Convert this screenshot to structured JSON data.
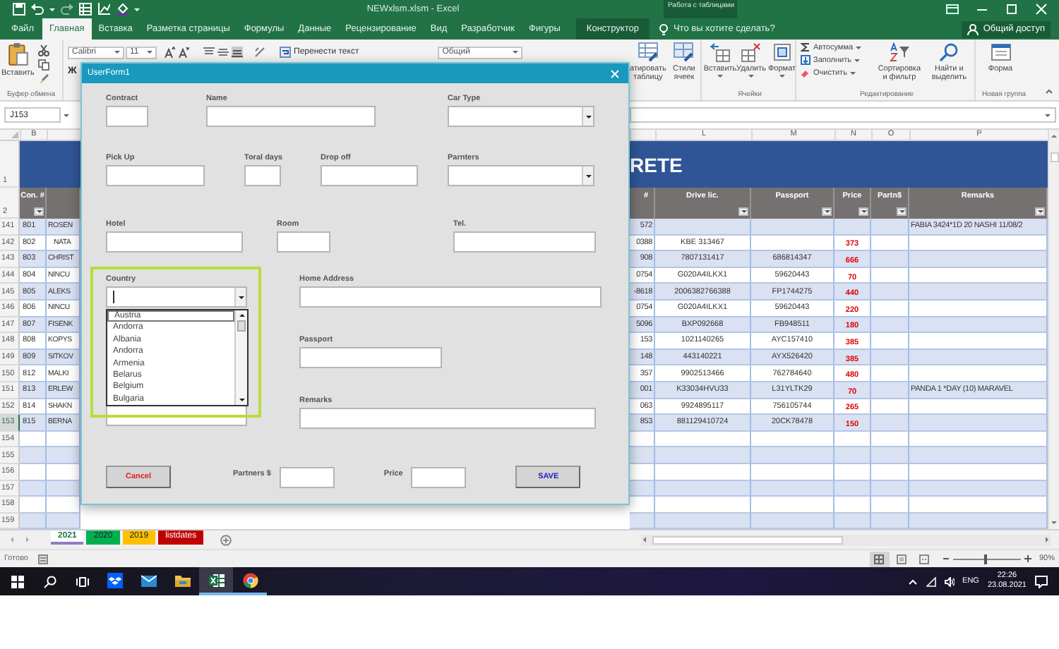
{
  "title_bar": {
    "title": "NEWxlsm.xlsm - Excel",
    "context_label": "Работа с таблицами"
  },
  "ribbon_tabs": [
    {
      "label": "Файл",
      "kind": "file",
      "selected": false
    },
    {
      "label": "Главная",
      "kind": "standard",
      "selected": true
    },
    {
      "label": "Вставка",
      "kind": "standard",
      "selected": false
    },
    {
      "label": "Разметка страницы",
      "kind": "standard",
      "selected": false
    },
    {
      "label": "Формулы",
      "kind": "standard",
      "selected": false
    },
    {
      "label": "Данные",
      "kind": "standard",
      "selected": false
    },
    {
      "label": "Рецензирование",
      "kind": "standard",
      "selected": false
    },
    {
      "label": "Вид",
      "kind": "standard",
      "selected": false
    },
    {
      "label": "Разработчик",
      "kind": "standard",
      "selected": false
    },
    {
      "label": "Фигуры",
      "kind": "standard",
      "selected": false
    },
    {
      "label": "Конструктор",
      "kind": "context",
      "selected": false
    }
  ],
  "tell_me": "Что вы хотите сделать?",
  "share": "Общий доступ",
  "ribbon": {
    "paste": "Вставить",
    "clipboard_group": "Буфер обмена",
    "bold": "Ж",
    "font": "Calibri",
    "font_size": "11",
    "wrap_text": "Перенести текст",
    "number_format": "Общий",
    "format_as_table": "атировать таблицу",
    "cell_styles": "Стили ячеек",
    "cell_buttons": [
      "Вставить",
      "Удалить",
      "Формат"
    ],
    "cells_group": "Ячейки",
    "editing_items": [
      "Автосумма",
      "Заполнить",
      "Очистить"
    ],
    "sort": "Сортировка и фильтр",
    "find": "Найти и выделить",
    "editing_group": "Редактирование",
    "form": "Форма",
    "new_group": "Новая группа"
  },
  "name_box": "J153",
  "sheet": {
    "header_rows": [
      "1",
      "2"
    ],
    "columns_left": [
      "B"
    ],
    "columns_right": [
      "L",
      "M",
      "N",
      "O",
      "P"
    ],
    "banner": "RETE",
    "header_left": "Con. #",
    "header_k": "#",
    "headers_right": [
      "Drive lic.",
      "Passport",
      "Price",
      "Partn$",
      "Remarks"
    ],
    "rows": [
      {
        "num": "141",
        "con": "801",
        "name": "ROSEN",
        "k": "572",
        "remarks": "FABIA 3424*1D 20 NASHI 11/08/2",
        "selected": false
      },
      {
        "num": "142",
        "con": "802",
        "name": "NATA",
        "k": "0388",
        "drive": "KBE 313467",
        "price": "373",
        "selected": false
      },
      {
        "num": "143",
        "con": "803",
        "name": "CHRIST",
        "k": "908",
        "drive": "7807131417",
        "passport": "686814347",
        "price": "666",
        "selected": false
      },
      {
        "num": "144",
        "con": "804",
        "name": "NINCU",
        "k": "0754",
        "drive": "G020A4ILKX1",
        "passport": "59620443",
        "price": "70",
        "selected": false
      },
      {
        "num": "145",
        "con": "805",
        "name": "ALEKS",
        "k": "-8618",
        "drive": "2006382766388",
        "passport": "FP1744275",
        "price": "440",
        "selected": false
      },
      {
        "num": "146",
        "con": "806",
        "name": "NINCU",
        "k": "0754",
        "drive": "G020A4ILKX1",
        "passport": "59620443",
        "price": "220",
        "selected": false
      },
      {
        "num": "147",
        "con": "807",
        "name": "FISENK",
        "k": "5096",
        "drive": "BXP092668",
        "passport": "FB948511",
        "price": "180",
        "selected": false
      },
      {
        "num": "148",
        "con": "808",
        "name": "KOPYS",
        "k": "153",
        "drive": "1021140265",
        "passport": "AYC157410",
        "price": "385",
        "selected": false
      },
      {
        "num": "149",
        "con": "809",
        "name": "SITKOV",
        "k": "148",
        "drive": "443140221",
        "passport": "AYX526420",
        "price": "385",
        "selected": false
      },
      {
        "num": "150",
        "con": "812",
        "name": "MALKI",
        "k": "357",
        "drive": "9902513466",
        "passport": "762784640",
        "price": "480",
        "selected": false
      },
      {
        "num": "151",
        "con": "813",
        "name": "ERLEW",
        "k": "001",
        "drive": "K33034HVU33",
        "passport": "L31YLTK29",
        "price": "70",
        "remarks": "PANDA 1 *DAY (10) MARAVEL",
        "selected": false
      },
      {
        "num": "152",
        "con": "814",
        "name": "SHAKN",
        "k": "063",
        "drive": "9924895117",
        "passport": "756105744",
        "price": "265",
        "selected": false
      },
      {
        "num": "153",
        "con": "815",
        "name": "BERNA",
        "k": "853",
        "drive": "881129410724",
        "passport": "20CK78478",
        "price": "150",
        "selected": true
      },
      {
        "num": "154",
        "selected": false
      },
      {
        "num": "155",
        "selected": false
      },
      {
        "num": "156",
        "selected": false
      },
      {
        "num": "157",
        "selected": false
      },
      {
        "num": "158",
        "selected": false
      },
      {
        "num": "159",
        "selected": false
      }
    ]
  },
  "sheet_tabs": [
    {
      "label": "2021",
      "selected": true,
      "color": "#8e7cc3"
    },
    {
      "label": "2020",
      "selected": false,
      "color": "#00b050"
    },
    {
      "label": "2019",
      "selected": false,
      "color": "#ffc000"
    },
    {
      "label": "listdates",
      "selected": false,
      "color": "#c00000"
    }
  ],
  "status_bar": {
    "text": "Готово",
    "zoom": {
      "label": "90%",
      "level": 0.46
    }
  },
  "form": {
    "title": "UserForm1",
    "rows": [
      [
        {
          "label": "Contract",
          "kind": "text"
        },
        {
          "label": "Name",
          "kind": "text"
        },
        {
          "label": "Car Type",
          "kind": "combo"
        }
      ],
      [
        {
          "label": "Pick Up",
          "kind": "text"
        },
        {
          "label": "Toral days",
          "kind": "text"
        },
        {
          "label": "Drop off",
          "kind": "text"
        },
        {
          "label": "Parnters",
          "kind": "combo"
        }
      ],
      [
        {
          "label": "Hotel",
          "kind": "text"
        },
        {
          "label": "Room",
          "kind": "text"
        },
        {
          "label": "Tel.",
          "kind": "text"
        }
      ]
    ],
    "country": {
      "label": "Country",
      "options": [
        {
          "label": "Austria",
          "selected": true
        },
        {
          "label": "Andorra",
          "selected": false
        },
        {
          "label": "Albania",
          "selected": false
        },
        {
          "label": "Andorra",
          "selected": false
        },
        {
          "label": "Armenia",
          "selected": false
        },
        {
          "label": "Belarus",
          "selected": false
        },
        {
          "label": "Belgium",
          "selected": false
        },
        {
          "label": "Bulgaria",
          "selected": false
        }
      ]
    },
    "right_fields": [
      {
        "label": "Home Address"
      },
      {
        "label": "Passport"
      },
      {
        "label": "Remarks"
      }
    ],
    "cancel": "Cancel",
    "partners_label": "Partners $",
    "price_label": "Price",
    "save": "SAVE"
  },
  "taskbar": {
    "apps": [
      {
        "kind": "dropbox",
        "selected": false,
        "active": false
      },
      {
        "kind": "mail",
        "selected": false,
        "active": false
      },
      {
        "kind": "explorer",
        "selected": false,
        "active": false
      },
      {
        "kind": "excel",
        "selected": true,
        "active": true
      },
      {
        "kind": "chrome",
        "selected": false,
        "active": true
      }
    ],
    "lang": "ENG",
    "time": "22:26",
    "date": "23.08.2021"
  }
}
